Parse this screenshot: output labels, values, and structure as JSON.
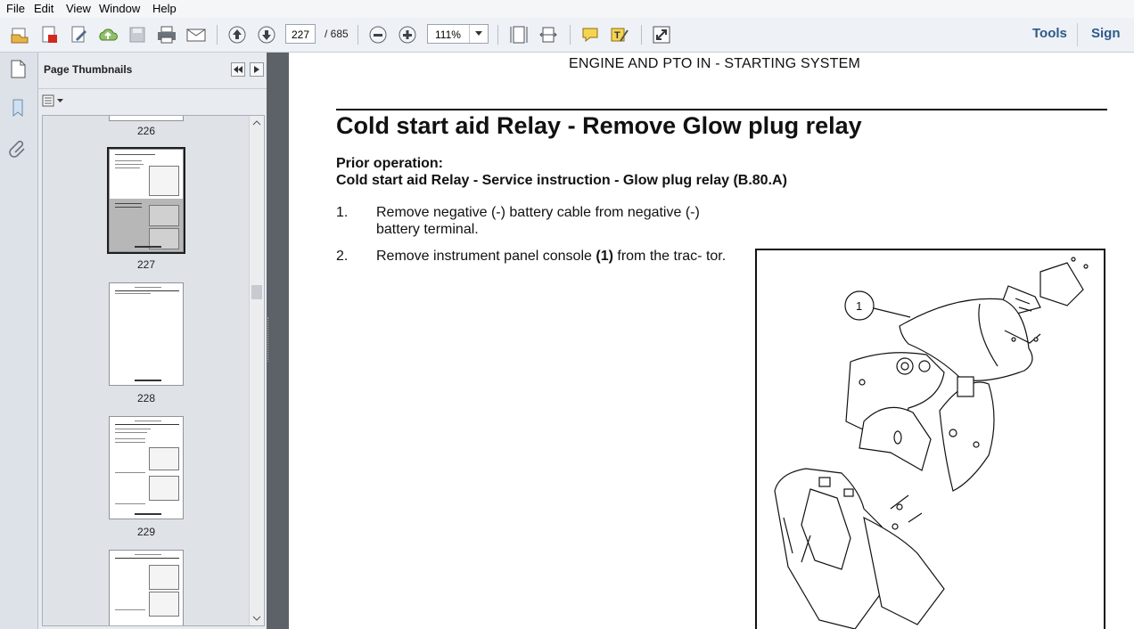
{
  "menu": [
    "File",
    "Edit",
    "View",
    "Window",
    "Help"
  ],
  "toolbar": {
    "page_current": "227",
    "page_total": "/ 685",
    "zoom": "111%",
    "tools_label": "Tools",
    "sign_label": "Sign"
  },
  "thumbnails_panel": {
    "title": "Page Thumbnails",
    "pages": [
      "226",
      "227",
      "228",
      "229"
    ]
  },
  "document": {
    "section_header": "ENGINE AND PTO IN - STARTING SYSTEM",
    "title": "Cold start aid Relay - Remove Glow plug relay",
    "prior_label": "Prior operation:",
    "prior_text": "Cold start aid Relay - Service instruction - Glow plug relay (B.80.A)",
    "steps": [
      {
        "num": "1.",
        "text": "Remove negative (-) battery cable from negative (-) battery terminal."
      },
      {
        "num": "2.",
        "text_before": "Remove instrument panel console ",
        "text_bold": "(1)",
        "text_after": " from the trac- tor."
      }
    ],
    "figure_callout": "1"
  }
}
